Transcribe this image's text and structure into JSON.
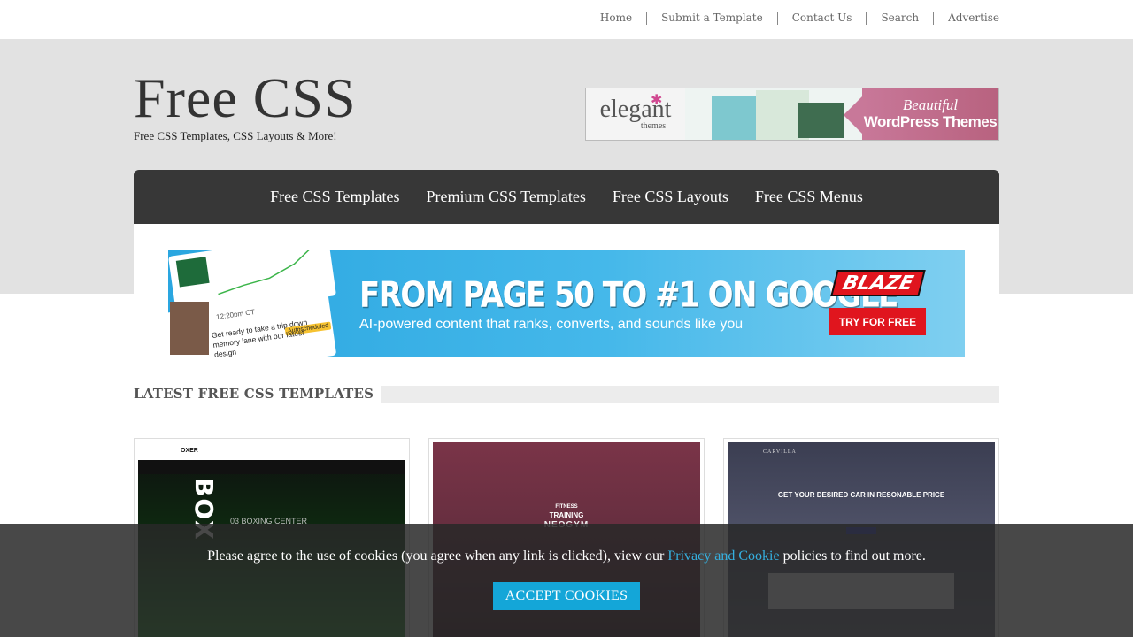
{
  "topnav": {
    "items": [
      "Home",
      "Submit a Template",
      "Contact Us",
      "Search",
      "Advertise"
    ]
  },
  "header": {
    "logo": "Free CSS",
    "tagline": "Free CSS Templates, CSS Layouts & More!"
  },
  "ad_elegant": {
    "brand": "elegant",
    "brand_sub": "themes",
    "promo_line1": "Beautiful",
    "promo_line2": "WordPress Themes"
  },
  "mainnav": {
    "items": [
      "Free CSS Templates",
      "Premium CSS Templates",
      "Free CSS Layouts",
      "Free CSS Menus"
    ]
  },
  "banner": {
    "headline": "FROM PAGE 50 TO #1 ON GOOGLE",
    "sub": "AI-powered content that ranks, converts, and sounds like you",
    "logo": "BLAZE",
    "cta": "TRY FOR FREE",
    "card_time": "12:20pm CT",
    "card_msg": "Get ready to take a trip down memory lane with our latest design",
    "card_tag": "Autoscheduled"
  },
  "section": {
    "title": "LATEST FREE CSS TEMPLATES"
  },
  "cards": [
    {
      "brand": "OXER",
      "hero": "BOX",
      "label": "03 BOXING CENTER"
    },
    {
      "line1": "FITNESS",
      "line2": "TRAINING",
      "line3": "NEOGYM"
    },
    {
      "brand": "CARVILLA",
      "hero": "GET YOUR DESIRED CAR IN RESONABLE PRICE"
    }
  ],
  "cookie": {
    "message_before": "Please agree to the use of cookies (you agree when any link is clicked), view our ",
    "link": "Privacy and Cookie",
    "message_after": " policies to find out more.",
    "button": "ACCEPT COOKIES"
  },
  "colors": {
    "nav_bg": "#373737",
    "header_bg": "#e2e2e2",
    "cookie_button": "#14a6d8",
    "cookie_link": "#35b0df",
    "banner_cta": "#e0151e"
  }
}
